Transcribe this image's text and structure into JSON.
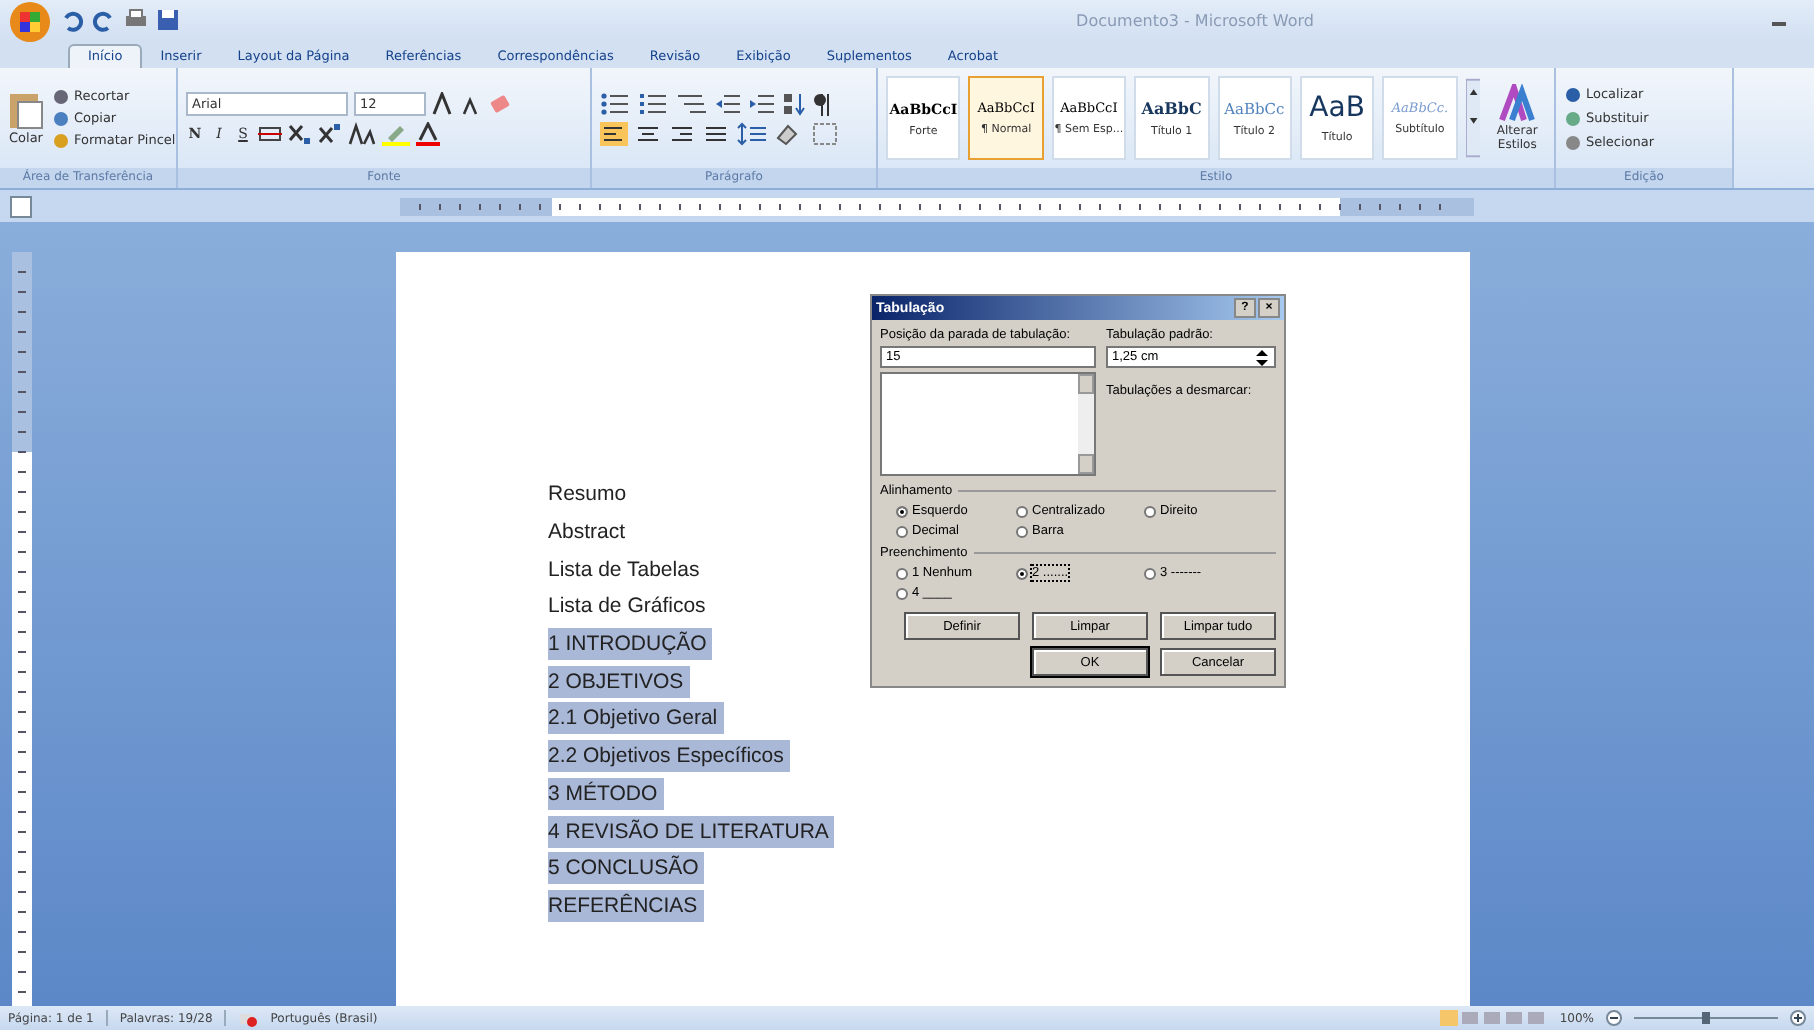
{
  "window": {
    "title": "Documento3 - Microsoft Word"
  },
  "tabs": [
    {
      "label": "Início",
      "selected": true
    },
    {
      "label": "Inserir",
      "selected": false
    },
    {
      "label": "Layout da Página",
      "selected": false
    },
    {
      "label": "Referências",
      "selected": false
    },
    {
      "label": "Correspondências",
      "selected": false
    },
    {
      "label": "Revisão",
      "selected": false
    },
    {
      "label": "Exibição",
      "selected": false
    },
    {
      "label": "Suplementos",
      "selected": false
    },
    {
      "label": "Acrobat",
      "selected": false
    }
  ],
  "clipboard": {
    "paste": "Colar",
    "items": [
      "Recortar",
      "Copiar",
      "Formatar Pincel"
    ],
    "label": "Área de Transferência"
  },
  "font": {
    "name": "Arial",
    "size": "12",
    "format_buttons": [
      "N",
      "I",
      "S"
    ],
    "label": "Fonte"
  },
  "paragraph": {
    "label": "Parágrafo"
  },
  "styles": {
    "label": "Estilo",
    "items": [
      {
        "preview": "AaBbCcI",
        "name": "Forte",
        "selected": false
      },
      {
        "preview": "AaBbCcI",
        "name": "¶ Normal",
        "selected": true
      },
      {
        "preview": "AaBbCcI",
        "name": "¶ Sem Esp...",
        "selected": false
      },
      {
        "preview": "AaBbC",
        "name": "Título 1",
        "selected": false
      },
      {
        "preview": "AaBbCc",
        "name": "Título 2",
        "selected": false
      },
      {
        "preview": "AaB",
        "name": "Título",
        "selected": false
      },
      {
        "preview": "AaBbCc.",
        "name": "Subtítulo",
        "selected": false
      }
    ],
    "change": "Alterar Estilos"
  },
  "editing": {
    "items": [
      "Localizar",
      "Substituir",
      "Selecionar"
    ],
    "label": "Edição"
  },
  "document": {
    "lines": [
      {
        "text": "Resumo",
        "selected": false
      },
      {
        "text": "Abstract",
        "selected": false
      },
      {
        "text": "Lista de Tabelas",
        "selected": false
      },
      {
        "text": "Lista de Gráficos",
        "selected": false
      },
      {
        "text": "1 INTRODUÇÃO",
        "selected": true
      },
      {
        "text": "2 OBJETIVOS",
        "selected": true
      },
      {
        "text": "2.1 Objetivo Geral",
        "selected": true
      },
      {
        "text": "2.2 Objetivos Específicos",
        "selected": true
      },
      {
        "text": "3 MÉTODO",
        "selected": true
      },
      {
        "text": "4 REVISÃO DE LITERATURA",
        "selected": true
      },
      {
        "text": "5 CONCLUSÃO",
        "selected": true
      },
      {
        "text": "REFERÊNCIAS",
        "selected": true
      }
    ]
  },
  "dialog": {
    "title": "Tabulação",
    "help": "?",
    "close": "×",
    "position_label": "Posição da parada de tabulação:",
    "position_value": "15",
    "default_label": "Tabulação padrão:",
    "default_value": "1,25 cm",
    "clear_label": "Tabulações a desmarcar:",
    "alignment": {
      "label": "Alinhamento",
      "options": [
        {
          "label": "Esquerdo",
          "selected": true
        },
        {
          "label": "Centralizado",
          "selected": false
        },
        {
          "label": "Direito",
          "selected": false
        },
        {
          "label": "Decimal",
          "selected": false
        },
        {
          "label": "Barra",
          "selected": false
        }
      ]
    },
    "leader": {
      "label": "Preenchimento",
      "options": [
        {
          "label": "1 Nenhum",
          "selected": false
        },
        {
          "label": "2 .......",
          "selected": true
        },
        {
          "label": "3 -------",
          "selected": false
        },
        {
          "label": "4 ____",
          "selected": false
        }
      ]
    },
    "buttons": [
      {
        "label": "Definir",
        "kind": "normal"
      },
      {
        "label": "Limpar",
        "kind": "normal"
      },
      {
        "label": "Limpar tudo",
        "kind": "normal"
      },
      {
        "label": "OK",
        "kind": "default"
      },
      {
        "label": "Cancelar",
        "kind": "normal"
      }
    ]
  },
  "status_bar": {
    "page": "Página: 1 de 1",
    "words": "Palavras: 19/28",
    "language": "Português (Brasil)",
    "zoom": "100%",
    "zoom_slider": {
      "level": 0.5
    }
  }
}
